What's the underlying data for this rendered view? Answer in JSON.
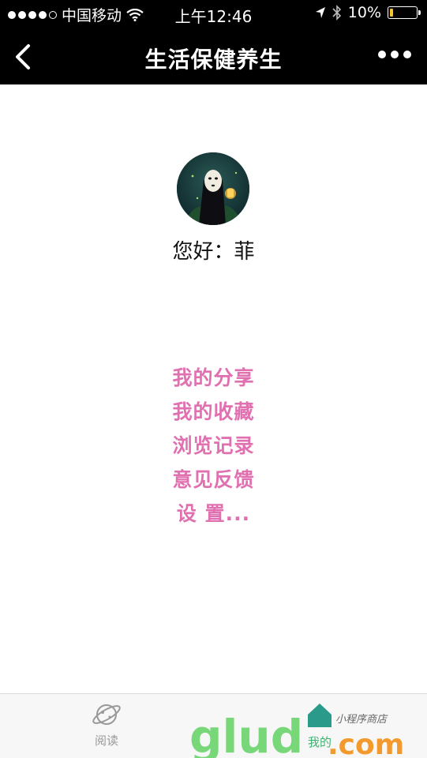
{
  "status_bar": {
    "carrier": "中国移动",
    "time": "上午12:46",
    "battery": "10%",
    "battery_level": 0.1
  },
  "nav": {
    "title": "生活保健养生",
    "back_icon": "chevron-left-icon",
    "more_icon": "more-dots-icon"
  },
  "profile": {
    "greeting": "您好：菲"
  },
  "menu": {
    "items": [
      "我的分享",
      "我的收藏",
      "浏览记录",
      "意见反馈",
      "设 置..."
    ]
  },
  "tabbar": {
    "read_label": "阅读",
    "mine_label": "我的"
  },
  "watermark": {
    "text": "glud.com",
    "subtitle": "小程序商店"
  },
  "colors": {
    "menu": "#e070b0",
    "nav_bg": "#000000",
    "tab_active": "#3cb371"
  }
}
